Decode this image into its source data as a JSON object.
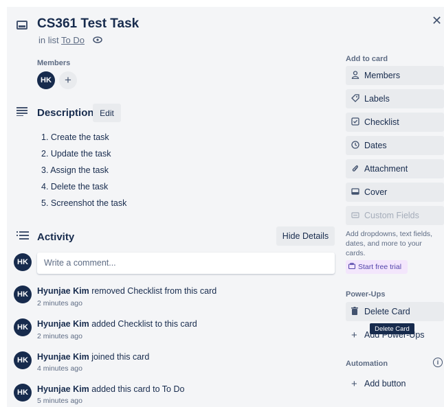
{
  "card": {
    "title": "CS361 Test Task",
    "in_list_prefix": "in list",
    "list_name": "To Do",
    "close_glyph": "✕"
  },
  "members": {
    "label": "Members",
    "avatar_initials": "HK",
    "add_glyph": "+"
  },
  "description": {
    "title": "Description",
    "edit_label": "Edit",
    "items": [
      "1. Create the task",
      "2. Update the task",
      "3. Assign the task",
      "4. Delete the task",
      "5. Screenshot the task"
    ]
  },
  "activity": {
    "title": "Activity",
    "hide_details_label": "Hide Details",
    "comment_placeholder": "Write a comment...",
    "avatar_initials": "HK",
    "entries": [
      {
        "user": "Hyunjae Kim",
        "action": " removed Checklist from this card",
        "time": "2 minutes ago"
      },
      {
        "user": "Hyunjae Kim",
        "action": " added Checklist to this card",
        "time": "2 minutes ago"
      },
      {
        "user": "Hyunjae Kim",
        "action": " joined this card",
        "time": "4 minutes ago"
      },
      {
        "user": "Hyunjae Kim",
        "action": " added this card to To Do",
        "time": "5 minutes ago"
      }
    ]
  },
  "sidebar": {
    "add_to_card_label": "Add to card",
    "buttons": [
      {
        "label": "Members",
        "icon": "person-icon"
      },
      {
        "label": "Labels",
        "icon": "label-icon"
      },
      {
        "label": "Checklist",
        "icon": "checklist-icon"
      },
      {
        "label": "Dates",
        "icon": "clock-icon"
      },
      {
        "label": "Attachment",
        "icon": "paperclip-icon"
      },
      {
        "label": "Cover",
        "icon": "cover-icon"
      },
      {
        "label": "Custom Fields",
        "icon": "custom-fields-icon"
      }
    ],
    "custom_fields_help": "Add dropdowns, text fields, dates, and more to your cards.",
    "trial_label": "Start free trial",
    "powerups_label": "Power-Ups",
    "delete_card_label": "Delete Card",
    "tooltip": "Delete Card",
    "add_powerups_label": "Add Power-Ups",
    "automation_label": "Automation",
    "add_button_label": "Add button",
    "info_glyph": "i"
  },
  "colors": {
    "avatar_bg": "#172b4d",
    "modal_bg": "#f4f5f7",
    "button_bg": "#e9ebee",
    "trial_bg": "#f3e6fc",
    "tooltip_bg": "#172b4d"
  }
}
